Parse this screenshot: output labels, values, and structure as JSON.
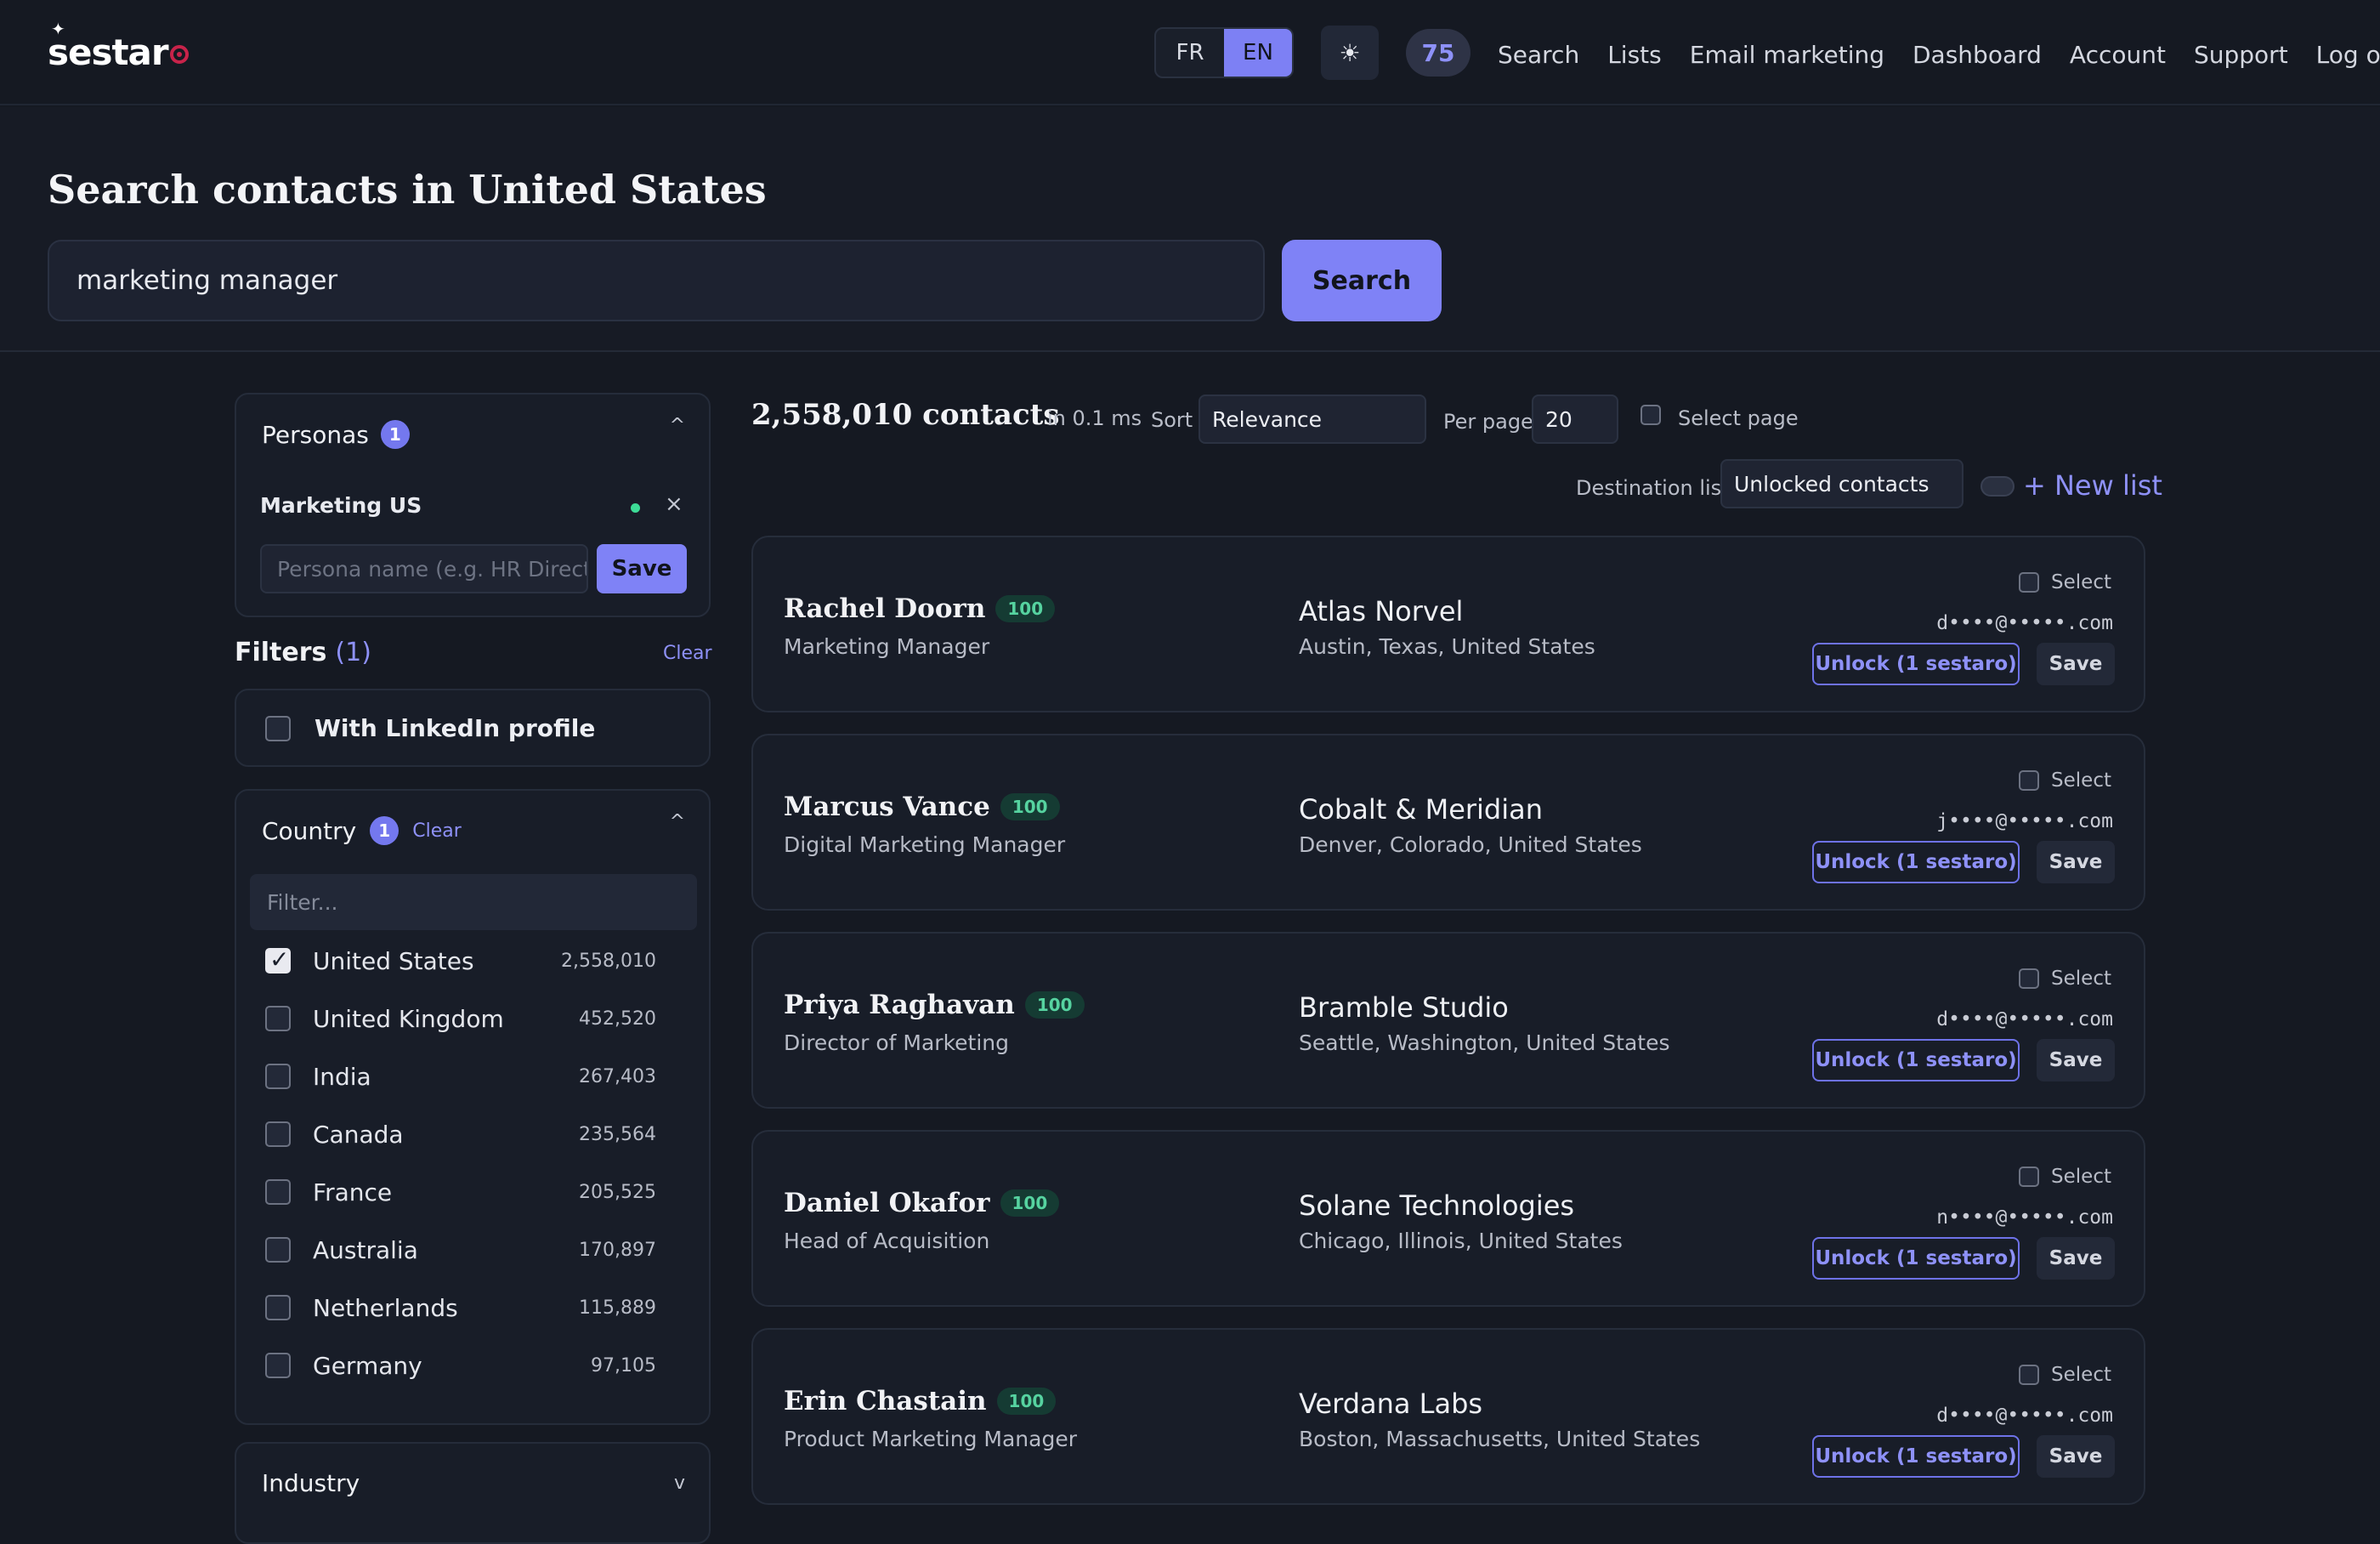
{
  "brand": {
    "name": "sestaro",
    "logo_text": "sestar"
  },
  "nav": {
    "languages": [
      "FR",
      "EN"
    ],
    "active_language": "EN",
    "theme_icon": "sun-icon",
    "credits": "75",
    "links": [
      "Search",
      "Lists",
      "Email marketing",
      "Dashboard",
      "Account",
      "Support",
      "Log out"
    ]
  },
  "hero": {
    "title": "Search contacts in United States",
    "query": "marketing manager",
    "search_button": "Search"
  },
  "personas": {
    "title": "Personas",
    "count": "1",
    "item": "Marketing US",
    "input_placeholder": "Persona name (e.g. HR Director)",
    "save_label": "Save"
  },
  "filters": {
    "title": "Filters",
    "count": "(1)",
    "clear": "Clear",
    "linkedin_label": "With LinkedIn profile"
  },
  "country": {
    "title": "Country",
    "count": "1",
    "clear": "Clear",
    "filter_placeholder": "Filter...",
    "items": [
      {
        "name": "United States",
        "count": "2,558,010",
        "checked": true
      },
      {
        "name": "United Kingdom",
        "count": "452,520",
        "checked": false
      },
      {
        "name": "India",
        "count": "267,403",
        "checked": false
      },
      {
        "name": "Canada",
        "count": "235,564",
        "checked": false
      },
      {
        "name": "France",
        "count": "205,525",
        "checked": false
      },
      {
        "name": "Australia",
        "count": "170,897",
        "checked": false
      },
      {
        "name": "Netherlands",
        "count": "115,889",
        "checked": false
      },
      {
        "name": "Germany",
        "count": "97,105",
        "checked": false
      }
    ]
  },
  "industry": {
    "title": "Industry"
  },
  "results": {
    "count": "2,558,010 contacts",
    "time": "in 0.1 ms",
    "sort_label": "Sort",
    "sort_value": "Relevance",
    "per_page_label": "Per page",
    "per_page_value": "20",
    "select_page": "Select page",
    "destination_label": "Destination list",
    "destination_value": "Unlocked contacts",
    "new_list": "+ New list"
  },
  "contacts": [
    {
      "name": "Rachel Doorn",
      "score": "100",
      "title": "Marketing Manager",
      "company": "Atlas Norvel",
      "location": "Austin, Texas, United States",
      "email": "d••••@•••••.com",
      "select": "Select",
      "unlock": "Unlock (1 sestaro)",
      "save": "Save"
    },
    {
      "name": "Marcus Vance",
      "score": "100",
      "title": "Digital Marketing Manager",
      "company": "Cobalt & Meridian",
      "location": "Denver, Colorado, United States",
      "email": "j••••@•••••.com",
      "select": "Select",
      "unlock": "Unlock (1 sestaro)",
      "save": "Save"
    },
    {
      "name": "Priya Raghavan",
      "score": "100",
      "title": "Director of Marketing",
      "company": "Bramble Studio",
      "location": "Seattle, Washington, United States",
      "email": "d••••@•••••.com",
      "select": "Select",
      "unlock": "Unlock (1 sestaro)",
      "save": "Save"
    },
    {
      "name": "Daniel Okafor",
      "score": "100",
      "title": "Head of Acquisition",
      "company": "Solane Technologies",
      "location": "Chicago, Illinois, United States",
      "email": "n••••@•••••.com",
      "select": "Select",
      "unlock": "Unlock (1 sestaro)",
      "save": "Save"
    },
    {
      "name": "Erin Chastain",
      "score": "100",
      "title": "Product Marketing Manager",
      "company": "Verdana Labs",
      "location": "Boston, Massachusetts, United States",
      "email": "d••••@•••••.com",
      "select": "Select",
      "unlock": "Unlock (1 sestaro)",
      "save": "Save"
    }
  ],
  "colors": {
    "accent": "#7f82f6",
    "score_text": "#56d3a0",
    "background": "#151922",
    "persona_dot": "#3ddc97"
  }
}
